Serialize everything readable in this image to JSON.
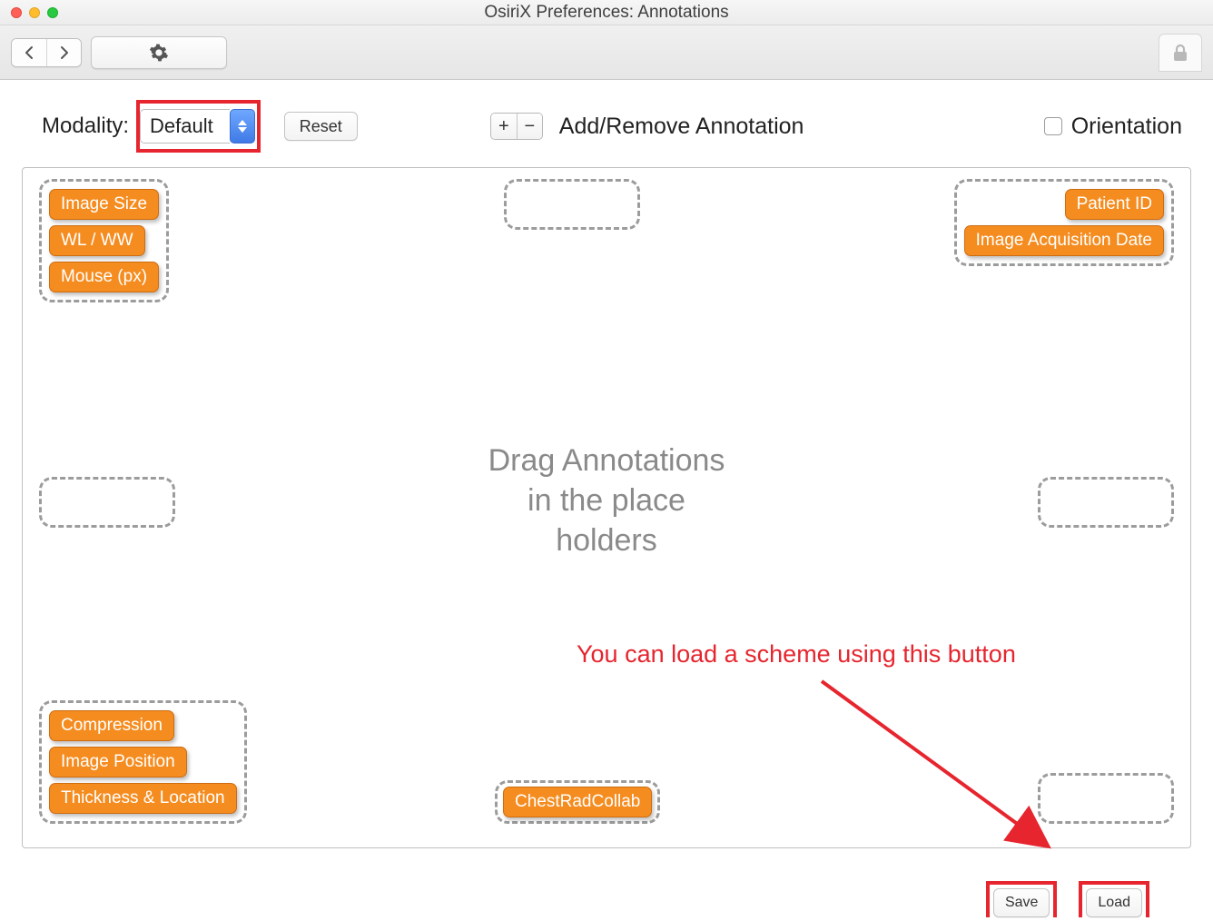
{
  "window": {
    "title": "OsiriX Preferences: Annotations"
  },
  "toolbar": {
    "back_icon": "chevron-left",
    "fwd_icon": "chevron-right",
    "gear_icon": "gear",
    "lock_icon": "lock"
  },
  "controls": {
    "modality_label": "Modality:",
    "modality_value": "Default",
    "reset_label": "Reset",
    "add_label": "+",
    "remove_label": "−",
    "section_label": "Add/Remove Annotation",
    "orientation_label": "Orientation"
  },
  "canvas": {
    "placeholder_text_l1": "Drag Annotations",
    "placeholder_text_l2": "in the place",
    "placeholder_text_l3": "holders",
    "top_left": [
      "Image Size",
      "WL / WW",
      "Mouse (px)"
    ],
    "top_right": [
      "Patient ID",
      "Image Acquisition Date"
    ],
    "bottom_left": [
      "Compression",
      "Image Position",
      "Thickness & Location"
    ],
    "bottom_center": [
      "ChestRadCollab"
    ]
  },
  "callout": {
    "text": "You can load a scheme using this button"
  },
  "bottom": {
    "save_label": "Save",
    "load_label": "Load"
  }
}
